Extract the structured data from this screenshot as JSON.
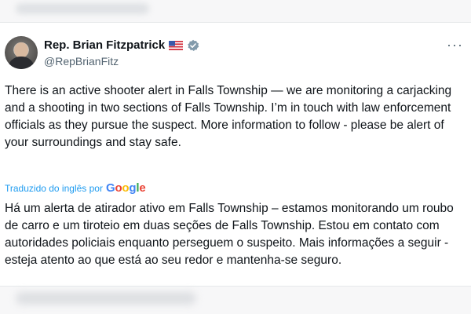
{
  "tweet": {
    "author_name": "Rep. Brian Fitzpatrick",
    "handle": "@RepBrianFitz",
    "more_icon": "more-dots-icon",
    "flag_icon": "us-flag-icon",
    "verified_icon": "verified-badge-icon",
    "text": "There is an active shooter alert in Falls Township — we are monitoring a carjacking and a shooting in two sections of Falls Township.  I’m in touch with law enforcement officials as they pursue the suspect.  More information to follow - please be alert of your surroundings and stay safe.",
    "translated_label": "Traduzido do inglês por",
    "translation_provider": {
      "letters": [
        "G",
        "o",
        "o",
        "g",
        "l",
        "e"
      ]
    },
    "translation_text": "Há um alerta de atirador ativo em Falls Township – estamos monitorando um roubo de carro e um tiroteio em duas seções de Falls Township. Estou em contato com autoridades policiais enquanto perseguem o suspeito. Mais informações a seguir - esteja atento ao que está ao seu redor e mantenha-se seguro."
  },
  "colors": {
    "link_blue": "#1d9bf0",
    "secondary_text": "#536471"
  }
}
